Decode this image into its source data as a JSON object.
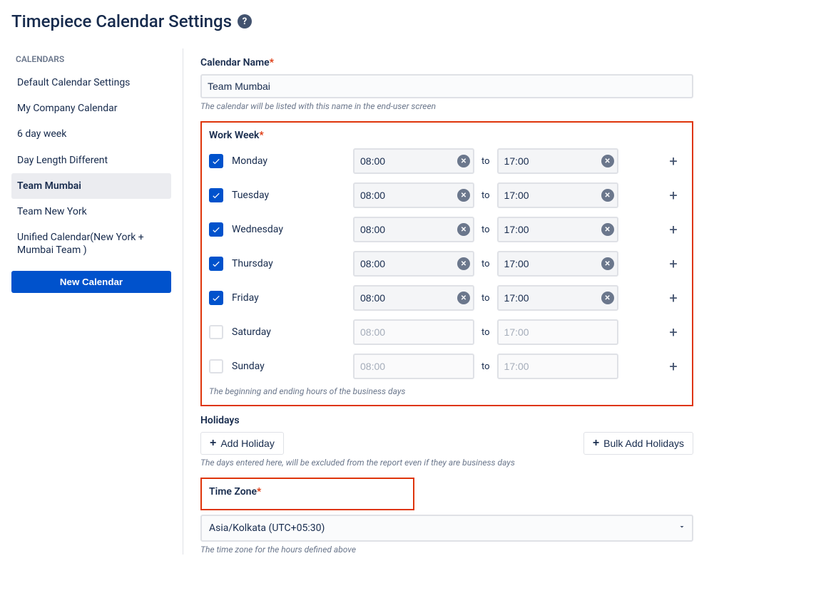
{
  "page_title": "Timepiece Calendar Settings",
  "sidebar": {
    "header": "CALENDARS",
    "items": [
      {
        "label": "Default Calendar Settings",
        "active": false
      },
      {
        "label": "My Company Calendar",
        "active": false
      },
      {
        "label": "6 day week",
        "active": false
      },
      {
        "label": "Day Length Different",
        "active": false
      },
      {
        "label": "Team Mumbai",
        "active": true
      },
      {
        "label": "Team New York",
        "active": false
      },
      {
        "label": "Unified Calendar(New York + Mumbai Team )",
        "active": false
      }
    ],
    "new_button": "New Calendar"
  },
  "calendar_name": {
    "label": "Calendar Name",
    "value": "Team Mumbai",
    "helper": "The calendar will be listed with this name in the end-user screen"
  },
  "work_week": {
    "label": "Work Week",
    "to_label": "to",
    "helper": "The beginning and ending hours of the business days",
    "days": [
      {
        "name": "Monday",
        "checked": true,
        "start": "08:00",
        "end": "17:00"
      },
      {
        "name": "Tuesday",
        "checked": true,
        "start": "08:00",
        "end": "17:00"
      },
      {
        "name": "Wednesday",
        "checked": true,
        "start": "08:00",
        "end": "17:00"
      },
      {
        "name": "Thursday",
        "checked": true,
        "start": "08:00",
        "end": "17:00"
      },
      {
        "name": "Friday",
        "checked": true,
        "start": "08:00",
        "end": "17:00"
      },
      {
        "name": "Saturday",
        "checked": false,
        "start": "08:00",
        "end": "17:00"
      },
      {
        "name": "Sunday",
        "checked": false,
        "start": "08:00",
        "end": "17:00"
      }
    ]
  },
  "holidays": {
    "label": "Holidays",
    "add_button": "Add Holiday",
    "bulk_button": "Bulk Add Holidays",
    "helper": "The days entered here, will be excluded from the report even if they are business days"
  },
  "timezone": {
    "label": "Time Zone",
    "value": "Asia/Kolkata (UTC+05:30)",
    "helper": "The time zone for the hours defined above"
  }
}
